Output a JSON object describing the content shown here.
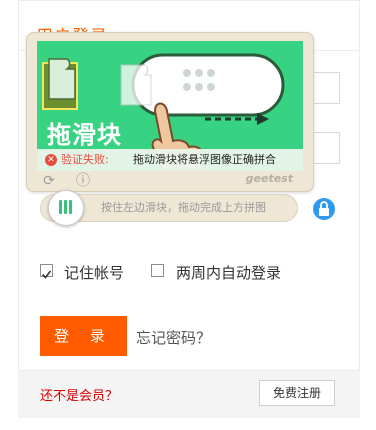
{
  "form": {
    "title": "用户登录",
    "remember_label": "记住帐号",
    "auto_login_label": "两周内自动登录",
    "login_label": "登 录",
    "forgot_label": "忘记密码？"
  },
  "captcha": {
    "image_title": "拖滑块",
    "fail_label": "验证失败:",
    "fail_message": "拖动滑块将悬浮图像正确拼合",
    "brand": "geetest",
    "slider_hint": "按住左边滑块，拖动完成上方拼图",
    "refresh_icon": "refresh-icon",
    "feedback_icon": "info-icon"
  },
  "footer": {
    "not_member_label": "还不是会员？",
    "register_label": "免费注册"
  },
  "colors": {
    "accent": "#ff5a00",
    "captcha_green": "#37d282",
    "error_red": "#e74c3c",
    "lock_blue": "#2e9bf0"
  }
}
